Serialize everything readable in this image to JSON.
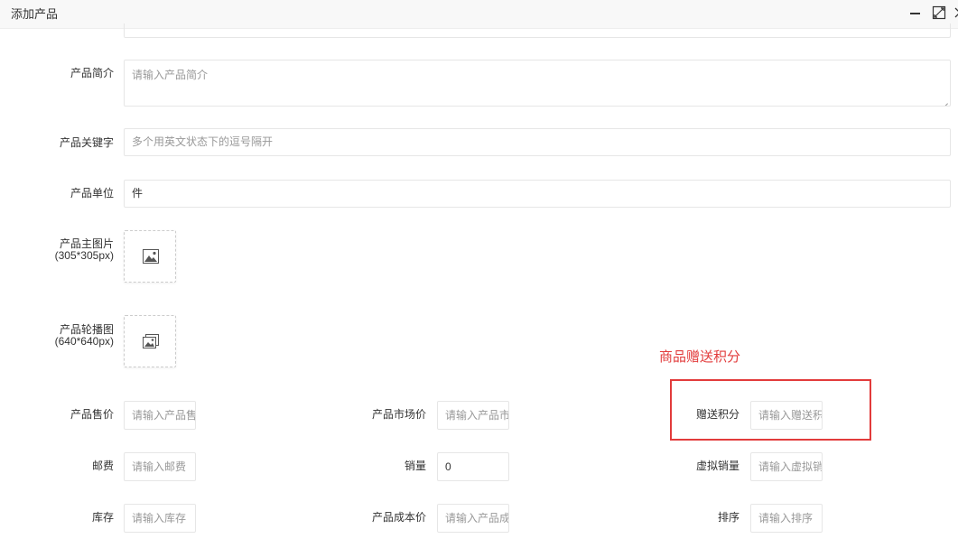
{
  "window": {
    "title": "添加产品"
  },
  "fields": {
    "intro_label": "产品简介",
    "intro_placeholder": "请输入产品简介",
    "keywords_label": "产品关键字",
    "keywords_placeholder": "多个用英文状态下的逗号隔开",
    "unit_label": "产品单位",
    "unit_value": "件",
    "main_image_label": "产品主图片",
    "main_image_size": "(305*305px)",
    "carousel_label": "产品轮播图",
    "carousel_size": "(640*640px)"
  },
  "grid": {
    "price_label": "产品售价",
    "price_placeholder": "请输入产品售",
    "market_price_label": "产品市场价",
    "market_price_placeholder": "请输入产品市",
    "points_label": "赠送积分",
    "points_placeholder": "请输入赠送积",
    "postage_label": "邮费",
    "postage_placeholder": "请输入邮费",
    "sales_label": "销量",
    "sales_value": "0",
    "virtual_sales_label": "虚拟销量",
    "virtual_sales_placeholder": "请输入虚拟销",
    "stock_label": "库存",
    "stock_placeholder": "请输入库存",
    "cost_label": "产品成本价",
    "cost_placeholder": "请输入产品成",
    "sort_label": "排序",
    "sort_placeholder": "请输入排序"
  },
  "annotation": {
    "text": "商品赠送积分",
    "color": "#e23b3b"
  },
  "icons": {
    "minimize": "minimize-icon",
    "maximize": "maximize-icon",
    "close": "close-icon",
    "image": "image-icon"
  }
}
